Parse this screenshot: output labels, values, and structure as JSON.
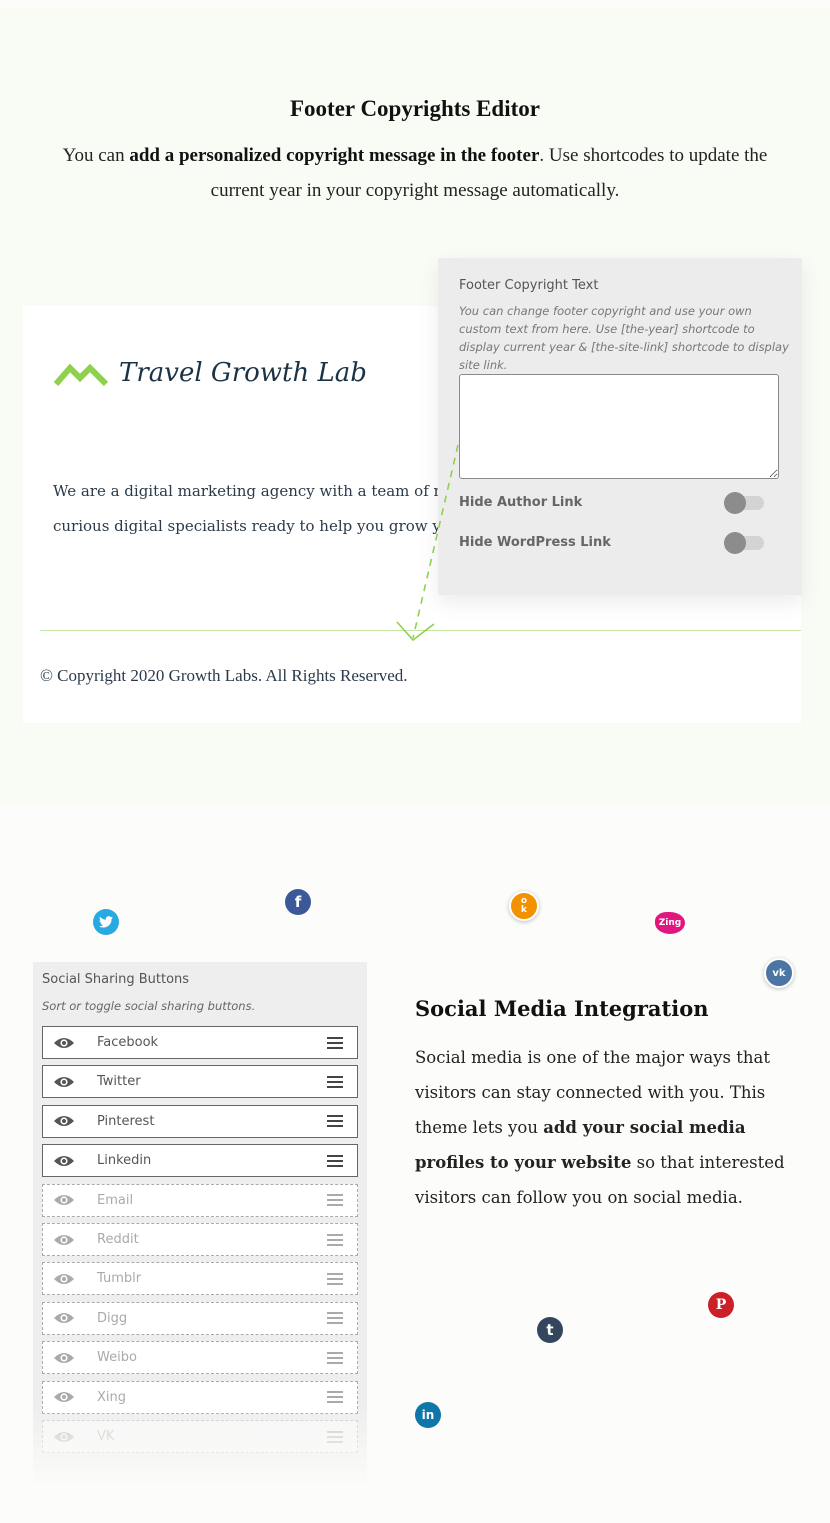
{
  "footer_editor": {
    "title": "Footer Copyrights Editor",
    "desc_pre": "You can ",
    "desc_bold": "add a personalized copyright message in the footer",
    "desc_post": ". Use shortcodes to update the current year in your copyright message automatically."
  },
  "preview": {
    "logo_text": "Travel Growth Lab",
    "about_line1": "We are a digital marketing agency with a team of m",
    "about_line2": "curious digital specialists ready to help you grow y",
    "copyright": "© Copyright 2020 Growth Labs. All Rights Reserved."
  },
  "copyright_panel": {
    "title": "Footer Copyright Text",
    "description": "You can change footer copyright and use your own custom text from here. Use [the-year] shortcode to display current year & [the-site-link] shortcode to display site link.",
    "textarea_value": "",
    "toggles": [
      {
        "label": "Hide Author Link",
        "on": false
      },
      {
        "label": "Hide WordPress Link",
        "on": false
      }
    ]
  },
  "social_icons": [
    {
      "name": "twitter",
      "glyph": "🐦",
      "color": "#29a9e1"
    },
    {
      "name": "facebook",
      "glyph": "f",
      "color": "#3b5998"
    },
    {
      "name": "odnoklassniki",
      "glyph": "ok",
      "color": "#f39200"
    },
    {
      "name": "zing",
      "glyph": "Zing",
      "color": "#e0187e"
    },
    {
      "name": "vk",
      "glyph": "vk",
      "color": "#4c75a3"
    },
    {
      "name": "tumblr",
      "glyph": "t",
      "color": "#34465d"
    },
    {
      "name": "pinterest",
      "glyph": "P",
      "color": "#cb2027"
    },
    {
      "name": "linkedin",
      "glyph": "in",
      "color": "#0e76a8"
    }
  ],
  "share_panel": {
    "title": "Social Sharing Buttons",
    "description": "Sort or toggle social sharing buttons.",
    "items": [
      {
        "label": "Facebook",
        "enabled": true
      },
      {
        "label": "Twitter",
        "enabled": true
      },
      {
        "label": "Pinterest",
        "enabled": true
      },
      {
        "label": "Linkedin",
        "enabled": true
      },
      {
        "label": "Email",
        "enabled": false
      },
      {
        "label": "Reddit",
        "enabled": false
      },
      {
        "label": "Tumblr",
        "enabled": false
      },
      {
        "label": "Digg",
        "enabled": false
      },
      {
        "label": "Weibo",
        "enabled": false
      },
      {
        "label": "Xing",
        "enabled": false
      },
      {
        "label": "VK",
        "enabled": false
      }
    ]
  },
  "social_integration": {
    "title": "Social Media Integration",
    "body_pre": "Social media is one of the major ways that visitors can stay connected with you. This theme lets you ",
    "body_bold": "add your social media profiles to your website",
    "body_post": " so that interested visitors can follow you on social media."
  },
  "colors": {
    "accent_green": "#8fd14f",
    "toggle_knob": "#8c8c8c"
  }
}
